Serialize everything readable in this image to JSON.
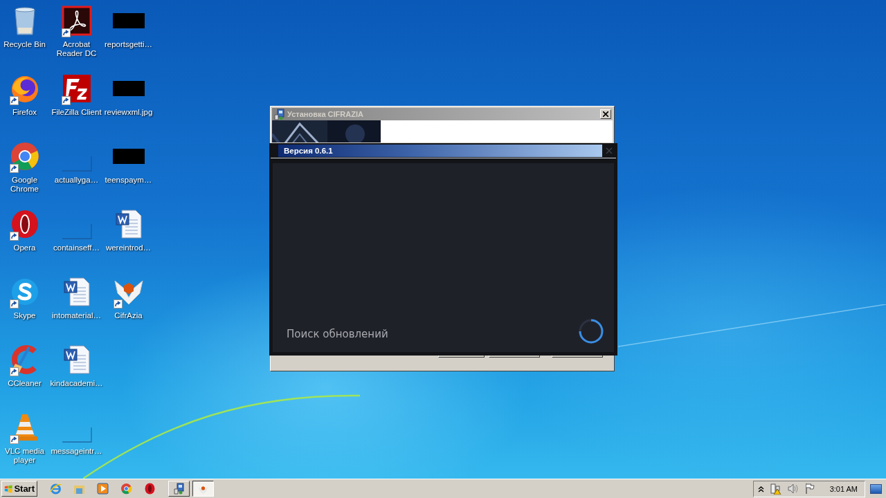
{
  "desktop": {
    "icons": [
      {
        "label": "Recycle Bin",
        "kind": "recycle",
        "shortcut": false
      },
      {
        "label": "Firefox",
        "kind": "firefox",
        "shortcut": true
      },
      {
        "label": "Google Chrome",
        "kind": "chrome",
        "shortcut": true
      },
      {
        "label": "Opera",
        "kind": "opera",
        "shortcut": true
      },
      {
        "label": "Skype",
        "kind": "skype",
        "shortcut": true
      },
      {
        "label": "CCleaner",
        "kind": "ccleaner",
        "shortcut": true
      },
      {
        "label": "VLC media player",
        "kind": "vlc",
        "shortcut": true
      },
      {
        "label": "Acrobat Reader DC",
        "kind": "acrobat",
        "shortcut": true
      },
      {
        "label": "FileZilla Client",
        "kind": "filezilla",
        "shortcut": true
      },
      {
        "label": "actuallyga…",
        "kind": "blank",
        "shortcut": false
      },
      {
        "label": "containseff…",
        "kind": "blank",
        "shortcut": false
      },
      {
        "label": "intomaterial…",
        "kind": "word",
        "shortcut": false
      },
      {
        "label": "kindacademi…",
        "kind": "word",
        "shortcut": false
      },
      {
        "label": "messageintr…",
        "kind": "blank",
        "shortcut": false
      },
      {
        "label": "reportsgetti…",
        "kind": "redacted",
        "shortcut": false
      },
      {
        "label": "reviewxml.jpg",
        "kind": "redacted",
        "shortcut": false
      },
      {
        "label": "teenspaym…",
        "kind": "redacted",
        "shortcut": false
      },
      {
        "label": "wereintrod…",
        "kind": "word",
        "shortcut": false
      },
      {
        "label": "CifrAzia",
        "kind": "cifrazia",
        "shortcut": true
      }
    ]
  },
  "installer_window": {
    "title": "Установка CIFRAZIA",
    "active": false
  },
  "update_dialog": {
    "title": "Версия 0.6.1",
    "status": "Поиск обновлений"
  },
  "taskbar": {
    "start": "Start",
    "quick_launch": [
      {
        "kind": "ie"
      },
      {
        "kind": "explorer"
      },
      {
        "kind": "media"
      },
      {
        "kind": "chrome"
      },
      {
        "kind": "opera"
      }
    ],
    "tasks": [
      {
        "kind": "installer",
        "selected": false
      },
      {
        "kind": "cifrazia",
        "selected": true
      }
    ],
    "tray": [
      {
        "kind": "chevron"
      },
      {
        "kind": "network"
      },
      {
        "kind": "speaker"
      },
      {
        "kind": "flag"
      }
    ],
    "clock": "3:01 AM"
  }
}
